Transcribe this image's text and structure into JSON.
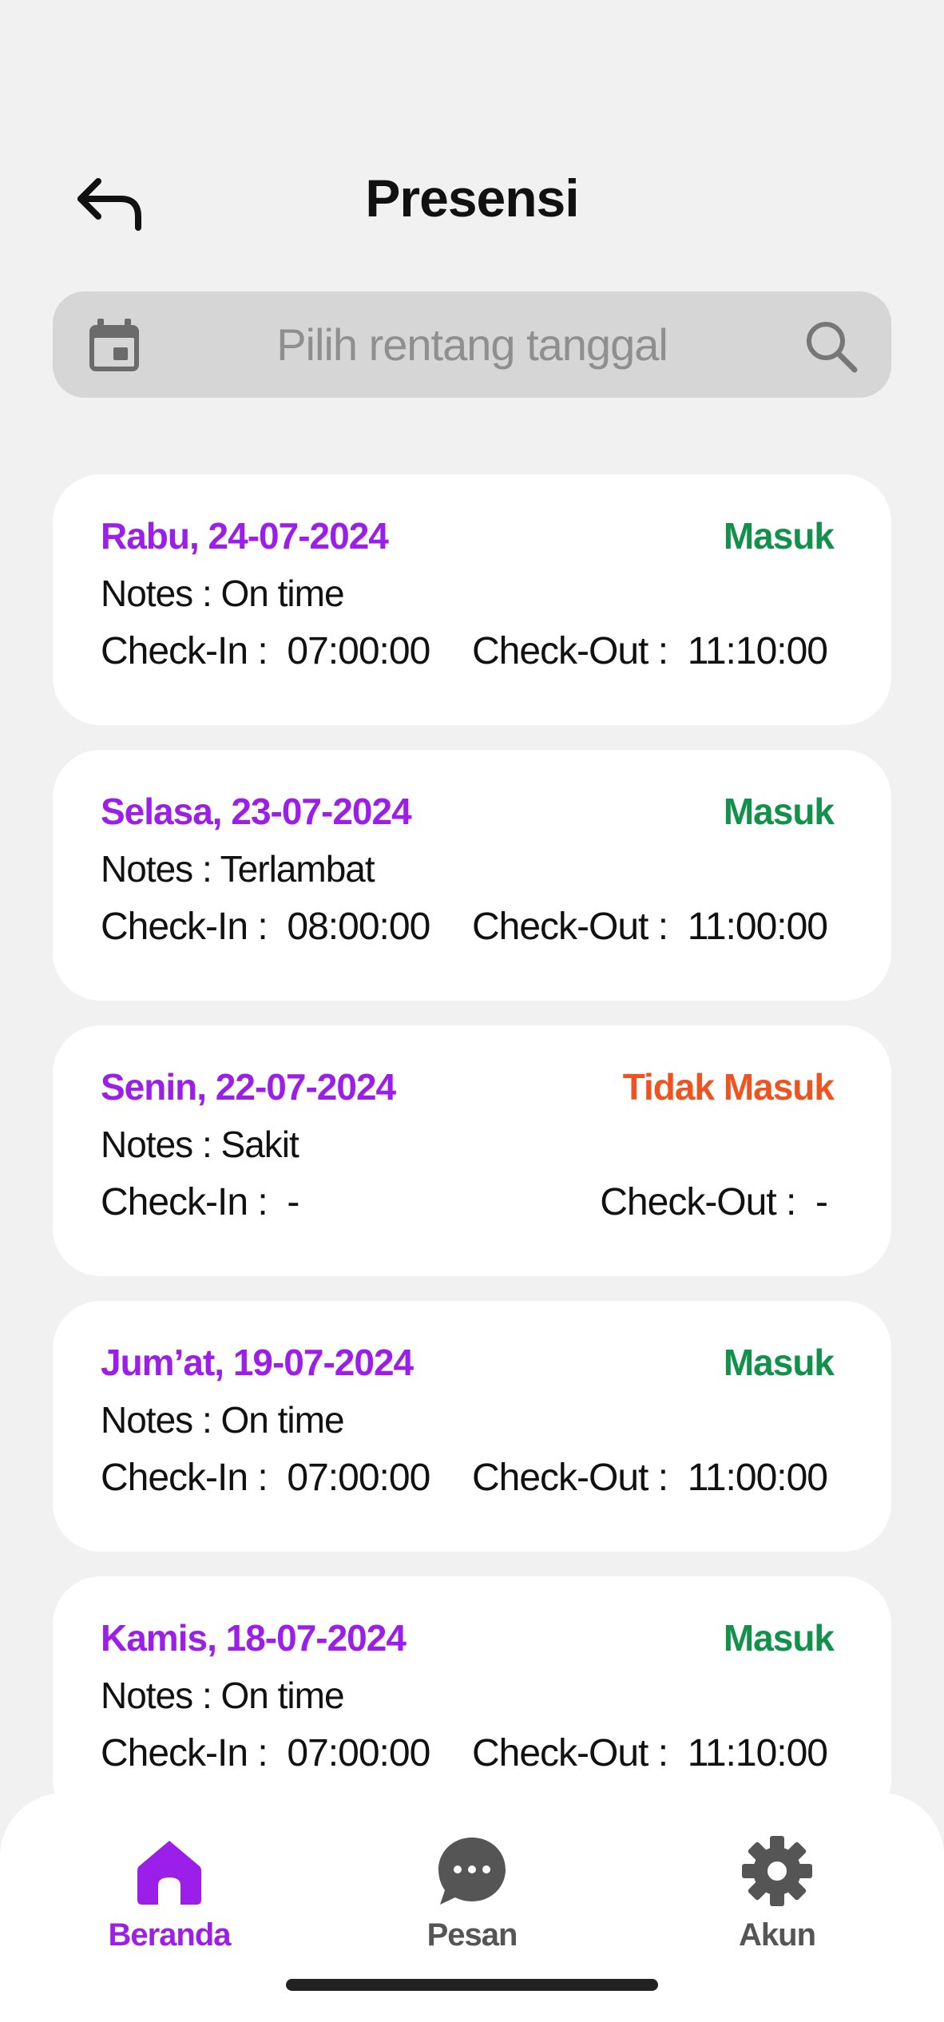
{
  "header": {
    "title": "Presensi",
    "back_icon": "back-arrow-icon"
  },
  "search": {
    "placeholder": "Pilih rentang tanggal",
    "left_icon": "calendar-icon",
    "right_icon": "search-icon"
  },
  "colors": {
    "date": "#9b1fe8",
    "present": "#12914a",
    "absent": "#ef5320",
    "nav_active": "#9b1fe8",
    "nav_inactive": "#555555"
  },
  "records": [
    {
      "date": "Rabu, 24-07-2024",
      "status": "Masuk",
      "status_type": "present",
      "notes": "Notes : On time",
      "check_in": "Check-In :  07:00:00",
      "check_out": "Check-Out :  11:10:00"
    },
    {
      "date": "Selasa, 23-07-2024",
      "status": "Masuk",
      "status_type": "present",
      "notes": "Notes : Terlambat",
      "check_in": "Check-In :  08:00:00",
      "check_out": "Check-Out :  11:00:00"
    },
    {
      "date": "Senin, 22-07-2024",
      "status": "Tidak Masuk",
      "status_type": "absent",
      "notes": "Notes : Sakit",
      "check_in": "Check-In :  -",
      "check_out": "Check-Out :  -"
    },
    {
      "date": "Jum’at, 19-07-2024",
      "status": "Masuk",
      "status_type": "present",
      "notes": "Notes : On time",
      "check_in": "Check-In :  07:00:00",
      "check_out": "Check-Out :  11:00:00"
    },
    {
      "date": "Kamis, 18-07-2024",
      "status": "Masuk",
      "status_type": "present",
      "notes": "Notes : On time",
      "check_in": "Check-In :  07:00:00",
      "check_out": "Check-Out :  11:10:00"
    }
  ],
  "nav": [
    {
      "label": "Beranda",
      "icon": "home-icon",
      "active": true
    },
    {
      "label": "Pesan",
      "icon": "chat-icon",
      "active": false
    },
    {
      "label": "Akun",
      "icon": "gear-icon",
      "active": false
    }
  ]
}
